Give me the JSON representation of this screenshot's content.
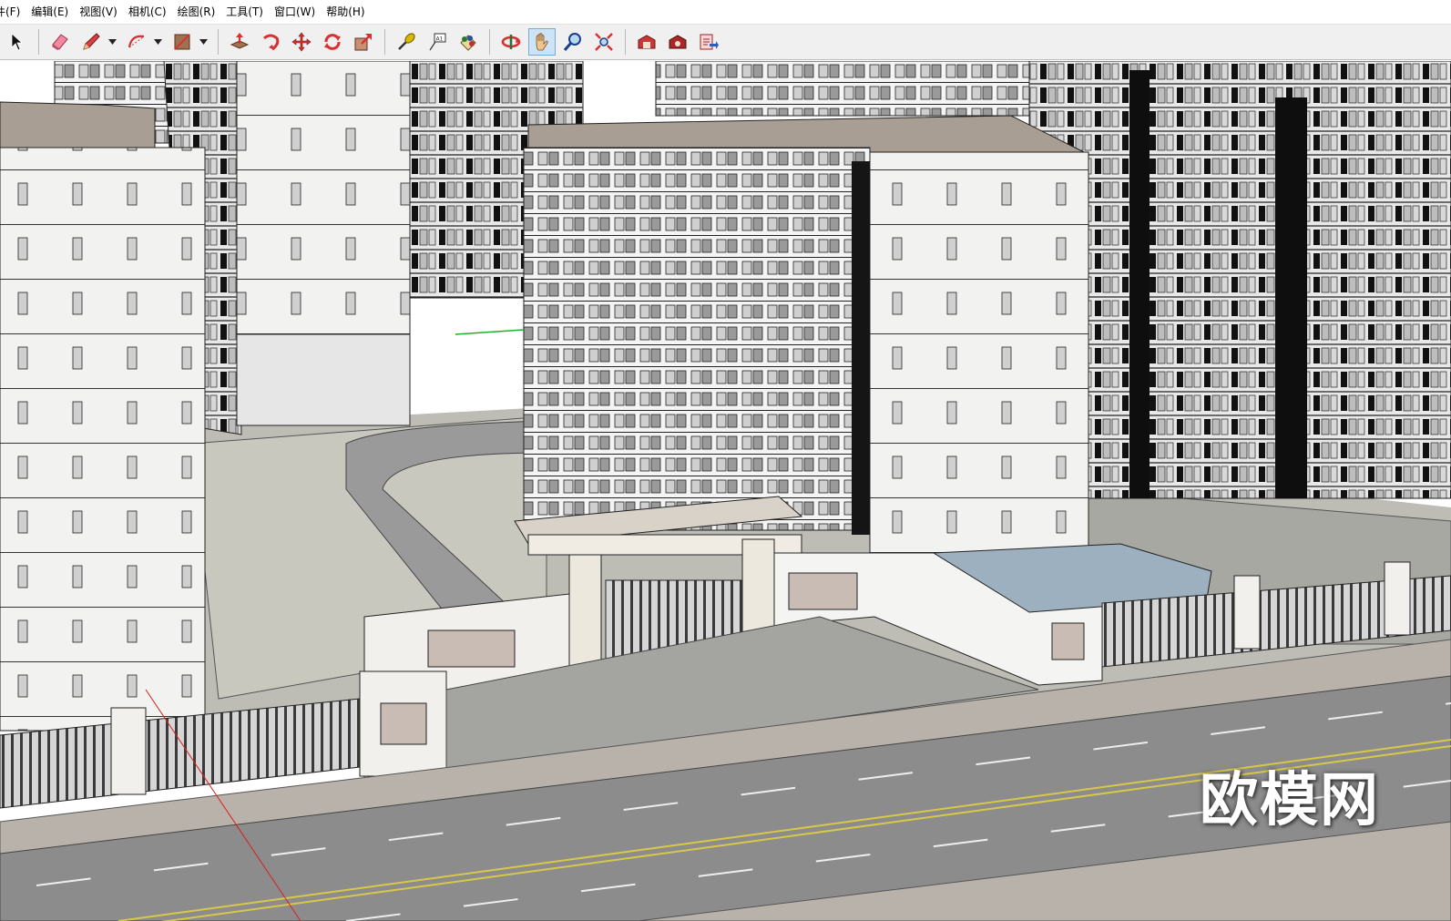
{
  "menubar": {
    "items": [
      "件(F)",
      "编辑(E)",
      "视图(V)",
      "相机(C)",
      "绘图(R)",
      "工具(T)",
      "窗口(W)",
      "帮助(H)"
    ]
  },
  "toolbar": {
    "tools": [
      {
        "name": "select-tool-icon",
        "color": "#000000"
      },
      {
        "name": "eraser-tool-icon",
        "color": "#e85a7a"
      },
      {
        "name": "pencil-tool-icon",
        "color": "#c03030"
      },
      {
        "name": "arc-tool-icon",
        "color": "#d83030"
      },
      {
        "name": "rectangle-tool-icon",
        "color": "#8c5a3a"
      },
      {
        "name": "push-pull-tool-icon",
        "color": "#d83030"
      },
      {
        "name": "follow-me-tool-icon",
        "color": "#d83030"
      },
      {
        "name": "move-tool-icon",
        "color": "#d83030"
      },
      {
        "name": "rotate-tool-icon",
        "color": "#d83030"
      },
      {
        "name": "scale-tool-icon",
        "color": "#d83030"
      },
      {
        "name": "tape-measure-tool-icon",
        "color": "#c0a000"
      },
      {
        "name": "text-tool-icon",
        "color": "#333333"
      },
      {
        "name": "paint-bucket-tool-icon",
        "color": "#c08020"
      },
      {
        "name": "orbit-tool-icon",
        "color": "#d83030"
      },
      {
        "name": "pan-tool-icon",
        "color": "#e8b070"
      },
      {
        "name": "zoom-tool-icon",
        "color": "#2a4f9a"
      },
      {
        "name": "zoom-extents-tool-icon",
        "color": "#d83030"
      },
      {
        "name": "warehouse-icon",
        "color": "#c03030"
      },
      {
        "name": "extension-warehouse-icon",
        "color": "#c03030"
      },
      {
        "name": "share-model-icon",
        "color": "#d83030"
      }
    ],
    "active_tool": "pan-tool-icon"
  },
  "viewport": {
    "watermark": "欧模网"
  }
}
